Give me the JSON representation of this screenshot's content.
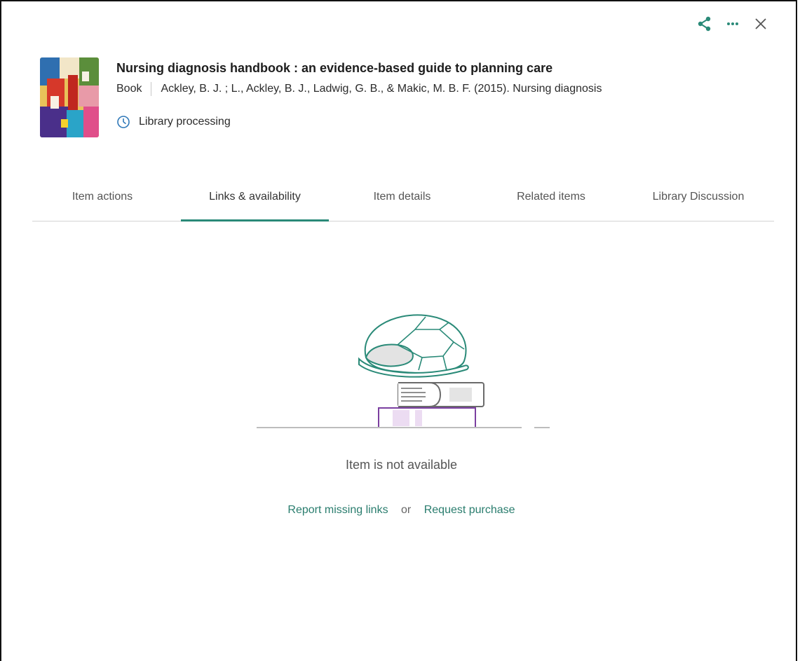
{
  "header": {
    "actions": [
      {
        "icon": "share-icon"
      },
      {
        "icon": "more-icon"
      },
      {
        "icon": "close-icon"
      }
    ]
  },
  "record": {
    "title": "Nursing diagnosis handbook : an evidence-based guide to planning care",
    "type": "Book",
    "citation": "Ackley, B. J. ; L., Ackley, B. J., Ladwig, G. B., & Makic, M. B. F.  (2015). Nursing diagnosis",
    "status": "Library processing",
    "status_icon": "clock-icon"
  },
  "tabs": [
    {
      "label": "Item actions",
      "active": false
    },
    {
      "label": "Links & availability",
      "active": true
    },
    {
      "label": "Item details",
      "active": false
    },
    {
      "label": "Related items",
      "active": false
    },
    {
      "label": "Library Discussion",
      "active": false
    }
  ],
  "empty_state": {
    "illustration": "turtle-on-books-illustration",
    "message": "Item is not available",
    "report_link": "Report missing links",
    "or_text": "or",
    "request_link": "Request purchase"
  },
  "colors": {
    "accent": "#2a8a78",
    "link": "#2a7d6e",
    "book_purple": "#7b3fa0"
  }
}
